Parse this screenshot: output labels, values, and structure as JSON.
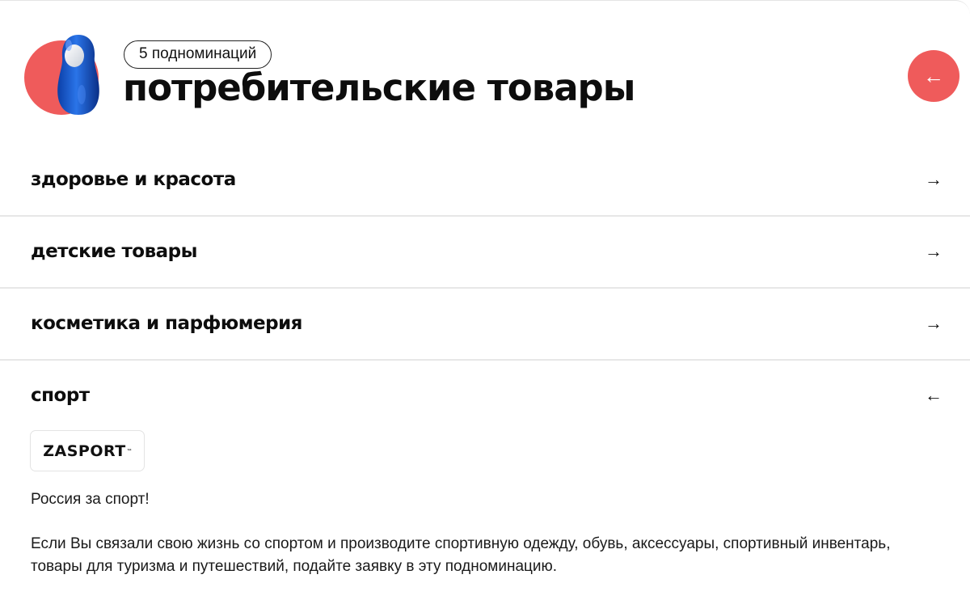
{
  "header": {
    "badge": "5 подноминаций",
    "title": "потребительские товары",
    "back_icon": "arrow-left-icon",
    "back_arrow": "←",
    "accent_color": "#ef5b5b",
    "mascot_color": "#1f5fd6"
  },
  "subnominations": [
    {
      "label": "здоровье и красота",
      "arrow": "→",
      "expanded": false
    },
    {
      "label": "детские товары",
      "arrow": "→",
      "expanded": false
    },
    {
      "label": "косметика и парфюмерия",
      "arrow": "→",
      "expanded": false
    },
    {
      "label": "спорт",
      "arrow": "←",
      "expanded": true
    }
  ],
  "expanded": {
    "logo": "ZASPORT",
    "logo_tm": "™",
    "slogan": "Россия за спорт!",
    "description": "Если Вы связали свою жизнь со спортом и производите спортивную одежду, обувь, аксессуары, спортивный инвентарь, товары для туризма и путешествий, подайте заявку в эту подноминацию."
  }
}
